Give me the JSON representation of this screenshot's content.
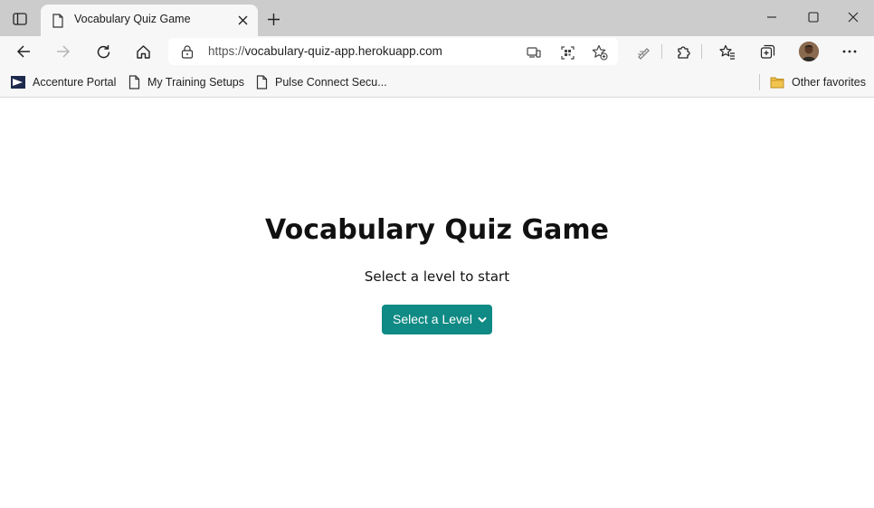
{
  "browser": {
    "tab": {
      "title": "Vocabulary Quiz Game"
    },
    "address_bar": {
      "protocol": "https://",
      "host": "vocabulary-quiz-app.herokuapp.com"
    },
    "favorites": [
      {
        "label": "Accenture Portal",
        "icon": "accenture-icon"
      },
      {
        "label": "My Training Setups",
        "icon": "page-icon"
      },
      {
        "label": "Pulse Connect Secu...",
        "icon": "page-icon"
      }
    ],
    "other_favorites": {
      "label": "Other favorites",
      "icon": "folder-icon"
    },
    "colors": {
      "titlebar": "#cccccc",
      "toolbar": "#f7f7f7",
      "folder": "#f3c44d"
    }
  },
  "page": {
    "heading": "Vocabulary Quiz Game",
    "subtitle": "Select a level to start",
    "level_select": {
      "selected": "Select a Level",
      "color": "#0f8a84"
    }
  }
}
